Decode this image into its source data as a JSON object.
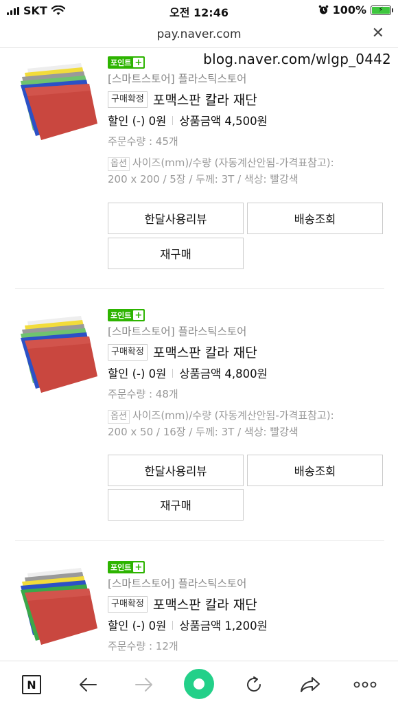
{
  "status_bar": {
    "carrier": "SKT",
    "time": "오전 12:46",
    "battery": "100%"
  },
  "browser": {
    "url": "pay.naver.com",
    "close_glyph": "✕"
  },
  "watermark": "blog.naver.com/wlgp_0442",
  "orders": [
    {
      "point_badge": "포인트",
      "store": "[스마트스토어] 플라스틱스토어",
      "confirm_badge": "구매확정",
      "product_name": "포맥스판 칼라 재단",
      "discount": "할인 (-) 0원",
      "amount": "상품금액 4,500원",
      "quantity": "주문수량 : 45개",
      "option_badge": "옵션",
      "option_line1": "사이즈(mm)/수량 (자동계산안됨-가격표참고):",
      "option_line2": "200 x 200 / 5장 / 두께: 3T / 색상: 빨강색",
      "review_label": "한달사용리뷰",
      "delivery_label": "배송조회",
      "rebuy_label": "재구매"
    },
    {
      "point_badge": "포인트",
      "store": "[스마트스토어] 플라스틱스토어",
      "confirm_badge": "구매확정",
      "product_name": "포맥스판 칼라 재단",
      "discount": "할인 (-) 0원",
      "amount": "상품금액 4,800원",
      "quantity": "주문수량 : 48개",
      "option_badge": "옵션",
      "option_line1": "사이즈(mm)/수량 (자동계산안됨-가격표참고):",
      "option_line2": "200 x 50 / 16장 / 두께: 3T / 색상: 빨강색",
      "review_label": "한달사용리뷰",
      "delivery_label": "배송조회",
      "rebuy_label": "재구매"
    },
    {
      "point_badge": "포인트",
      "store": "[스마트스토어] 플라스틱스토어",
      "confirm_badge": "구매확정",
      "product_name": "포맥스판 칼라 재단",
      "discount": "할인 (-) 0원",
      "amount": "상품금액 1,200원",
      "quantity": "주문수량 : 12개"
    }
  ],
  "toolbar": {
    "n_label": "N",
    "icons": [
      "naver-n-icon",
      "back-arrow-icon",
      "forward-arrow-icon",
      "green-dot-icon",
      "refresh-icon",
      "share-icon",
      "more-icon"
    ]
  },
  "colors": {
    "point_green": "#2db400",
    "toolbar_green": "#23d089",
    "product_red": "#c9473f"
  }
}
